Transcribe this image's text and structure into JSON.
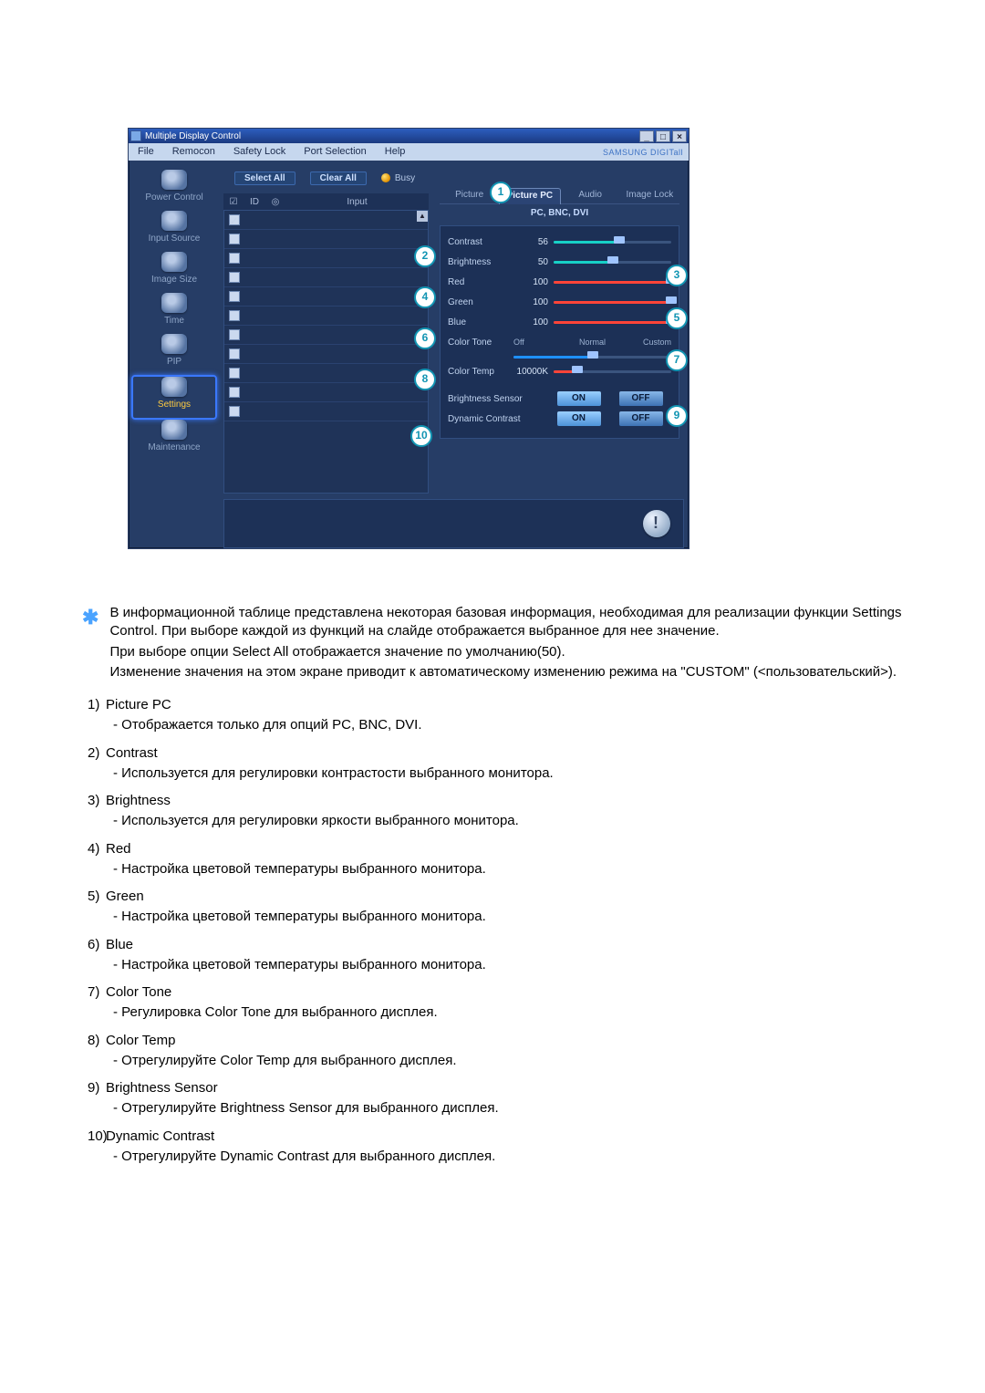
{
  "window": {
    "title": "Multiple Display Control",
    "brand": "SAMSUNG DIGITall",
    "menu": [
      "File",
      "Remocon",
      "Safety Lock",
      "Port Selection",
      "Help"
    ],
    "win_buttons": {
      "min": "_",
      "max": "□",
      "close": "×"
    }
  },
  "sidebar": [
    {
      "label": "Power Control"
    },
    {
      "label": "Input Source"
    },
    {
      "label": "Image Size"
    },
    {
      "label": "Time"
    },
    {
      "label": "PIP"
    },
    {
      "label": "Settings",
      "active": true
    },
    {
      "label": "Maintenance"
    }
  ],
  "toolbar": {
    "select_all": "Select All",
    "clear_all": "Clear All",
    "busy": "Busy"
  },
  "table": {
    "headers": {
      "id": "ID",
      "input": "Input"
    },
    "row_count": 11,
    "first_checked": true
  },
  "tabs": {
    "items": [
      "Picture",
      "Picture PC",
      "Audio",
      "Image Lock"
    ],
    "active_index": 1
  },
  "subheader": "PC, BNC, DVI",
  "settings": {
    "contrast": {
      "label": "Contrast",
      "value": "56",
      "pct": 56
    },
    "brightness": {
      "label": "Brightness",
      "value": "50",
      "pct": 50
    },
    "red": {
      "label": "Red",
      "value": "100",
      "pct": 100
    },
    "green": {
      "label": "Green",
      "value": "100",
      "pct": 100
    },
    "blue": {
      "label": "Blue",
      "value": "100",
      "pct": 100
    },
    "color_tone": {
      "label": "Color Tone",
      "ticks": [
        "Off",
        "Normal",
        "Custom"
      ],
      "pct": 50
    },
    "color_temp": {
      "label": "Color Temp",
      "value": "10000K",
      "pct": 20
    },
    "brightness_sensor": {
      "label": "Brightness Sensor",
      "on": "ON",
      "off": "OFF"
    },
    "dynamic_contrast": {
      "label": "Dynamic Contrast",
      "on": "ON",
      "off": "OFF"
    }
  },
  "callouts": [
    "1",
    "2",
    "3",
    "4",
    "5",
    "6",
    "7",
    "8",
    "9",
    "10"
  ],
  "doc": {
    "intro": [
      "В информационной таблице представлена некоторая базовая информация, необходимая для реализации функции Settings Control. При выборе каждой из функций на слайде отображается выбранное для нее значение.",
      "При выборе опции Select All отображается значение по умолчанию(50).",
      "Изменение значения на этом экране приводит к автоматическому изменению режима на \"CUSTOM\" (<пользовательский>)."
    ],
    "items": [
      {
        "n": "1)",
        "title": "Picture PC",
        "sub": "- Отображается только для опций PC, BNC, DVI."
      },
      {
        "n": "2)",
        "title": "Contrast",
        "sub": "- Используется для регулировки контрастости выбранного монитора."
      },
      {
        "n": "3)",
        "title": "Brightness",
        "sub": "- Используется для регулировки яркости выбранного монитора."
      },
      {
        "n": "4)",
        "title": "Red",
        "sub": "- Настройка цветовой температуры выбранного монитора."
      },
      {
        "n": "5)",
        "title": "Green",
        "sub": "- Настройка цветовой температуры выбранного монитора."
      },
      {
        "n": "6)",
        "title": "Blue",
        "sub": "- Настройка цветовой температуры выбранного монитора."
      },
      {
        "n": "7)",
        "title": "Color Tone",
        "sub": "- Регулировка Color Tone для выбранного дисплея."
      },
      {
        "n": "8)",
        "title": "Color Temp",
        "sub": "- Отрегулируйте Color Temp для выбранного дисплея."
      },
      {
        "n": "9)",
        "title": "Brightness Sensor",
        "sub": "- Отрегулируйте Brightness Sensor для выбранного дисплея."
      },
      {
        "n": "10)",
        "title": "Dynamic Contrast",
        "sub": "- Отрегулируйте Dynamic Contrast для выбранного дисплея."
      }
    ]
  }
}
